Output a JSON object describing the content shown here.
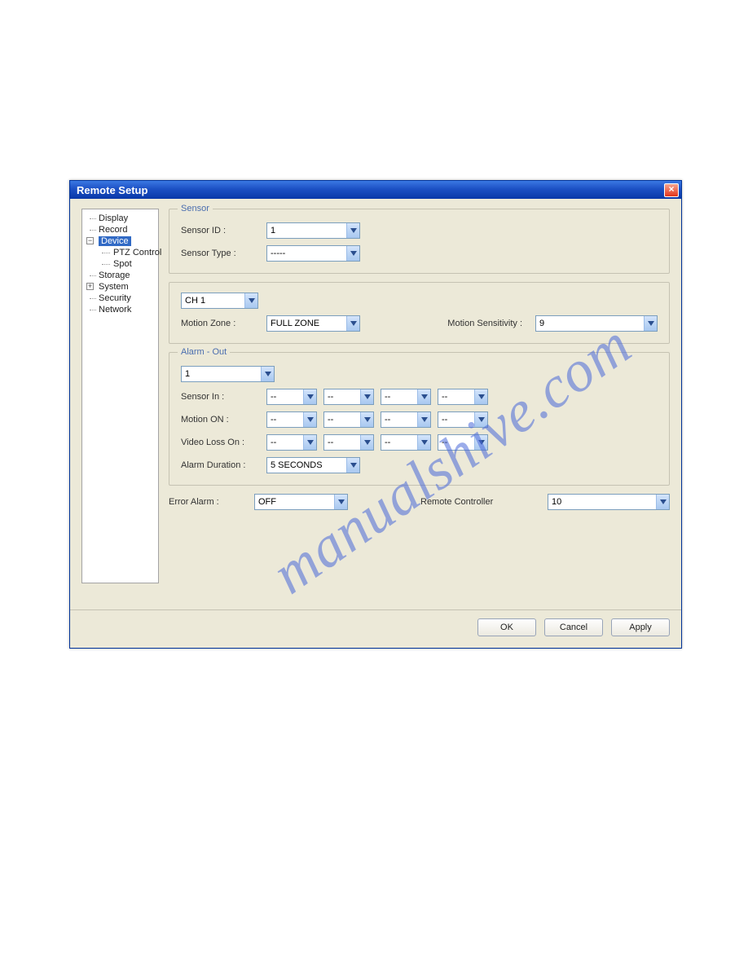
{
  "window": {
    "title": "Remote Setup",
    "close_icon": "×"
  },
  "tree": {
    "display": "Display",
    "record": "Record",
    "device": "Device",
    "device_exp": "−",
    "ptz": "PTZ Control",
    "spot": "Spot",
    "storage": "Storage",
    "system": "System",
    "system_exp": "+",
    "security": "Security",
    "network": "Network"
  },
  "sensor": {
    "legend": "Sensor",
    "id_label": "Sensor ID :",
    "id_value": "1",
    "type_label": "Sensor Type :",
    "type_value": "-----"
  },
  "motion": {
    "channel": "CH 1",
    "zone_label": "Motion Zone :",
    "zone_value": "FULL ZONE",
    "sens_label": "Motion Sensitivity :",
    "sens_value": "9"
  },
  "alarm": {
    "legend": "Alarm - Out",
    "out_value": "1",
    "sensor_in_label": "Sensor In :",
    "motion_on_label": "Motion ON :",
    "video_loss_label": "Video Loss On :",
    "duration_label": "Alarm Duration :",
    "duration_value": "5 SECONDS",
    "dash": "--"
  },
  "bottom": {
    "error_alarm_label": "Error Alarm :",
    "error_alarm_value": "OFF",
    "remote_label": "Remote Controller",
    "remote_value": "10"
  },
  "buttons": {
    "ok": "OK",
    "cancel": "Cancel",
    "apply": "Apply"
  },
  "watermark": "manualshive.com"
}
